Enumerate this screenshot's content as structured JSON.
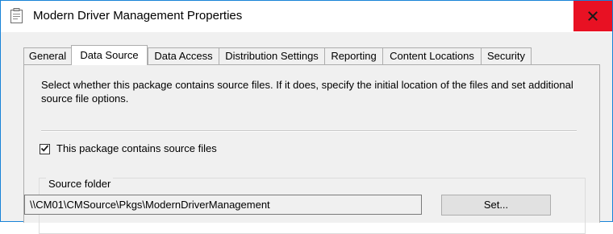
{
  "window": {
    "title": "Modern Driver Management Properties",
    "close_glyph": "x",
    "accent": "#1883d7",
    "close_color": "#e81123"
  },
  "tabs": [
    {
      "label": "General",
      "active": false
    },
    {
      "label": "Data Source",
      "active": true
    },
    {
      "label": "Data Access",
      "active": false
    },
    {
      "label": "Distribution Settings",
      "active": false
    },
    {
      "label": "Reporting",
      "active": false
    },
    {
      "label": "Content Locations",
      "active": false
    },
    {
      "label": "Security",
      "active": false
    }
  ],
  "panel": {
    "description": "Select whether this package contains source files. If it does, specify the initial location of the files and set additional source file options.",
    "contains_source_files": {
      "label": "This package contains source files",
      "checked": true
    },
    "source_folder": {
      "legend": "Source folder",
      "path": "\\\\CM01\\CMSource\\Pkgs\\ModernDriverManagement",
      "set_button": "Set..."
    }
  },
  "icons": {
    "window": "properties-window-icon",
    "close": "close-icon",
    "check": "checkmark-icon"
  }
}
